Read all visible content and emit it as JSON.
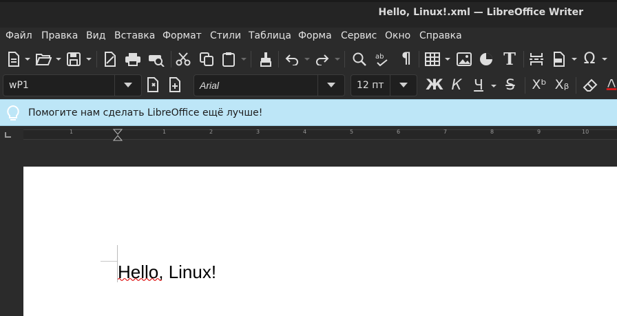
{
  "window": {
    "title": "Hello, Linux!.xml — LibreOffice Writer"
  },
  "menu": [
    "Файл",
    "Правка",
    "Вид",
    "Вставка",
    "Формат",
    "Стили",
    "Таблица",
    "Форма",
    "Сервис",
    "Окно",
    "Справка"
  ],
  "toolbar": {
    "paragraph_style": "wP1",
    "font_name": "Arial",
    "font_size": "12 пт",
    "bold": "Ж",
    "italic": "К",
    "underline": "Ч",
    "strike": "S",
    "superscript": "Xᵇ",
    "subscript": "Xᵦ",
    "special_char": "Ω",
    "formatting_marks": "¶",
    "text_box": "T"
  },
  "infobar": {
    "message": "Помогите нам сделать LibreOffice ещё лучше!"
  },
  "ruler": {
    "numbers": [
      "1",
      "1",
      "2",
      "3",
      "4",
      "5",
      "6",
      "7",
      "8",
      "9",
      "10"
    ]
  },
  "document": {
    "text": "Hello, Linux!"
  },
  "colors": {
    "accent": "#bde6f7",
    "font_color_indicator": "#d81b1b"
  }
}
